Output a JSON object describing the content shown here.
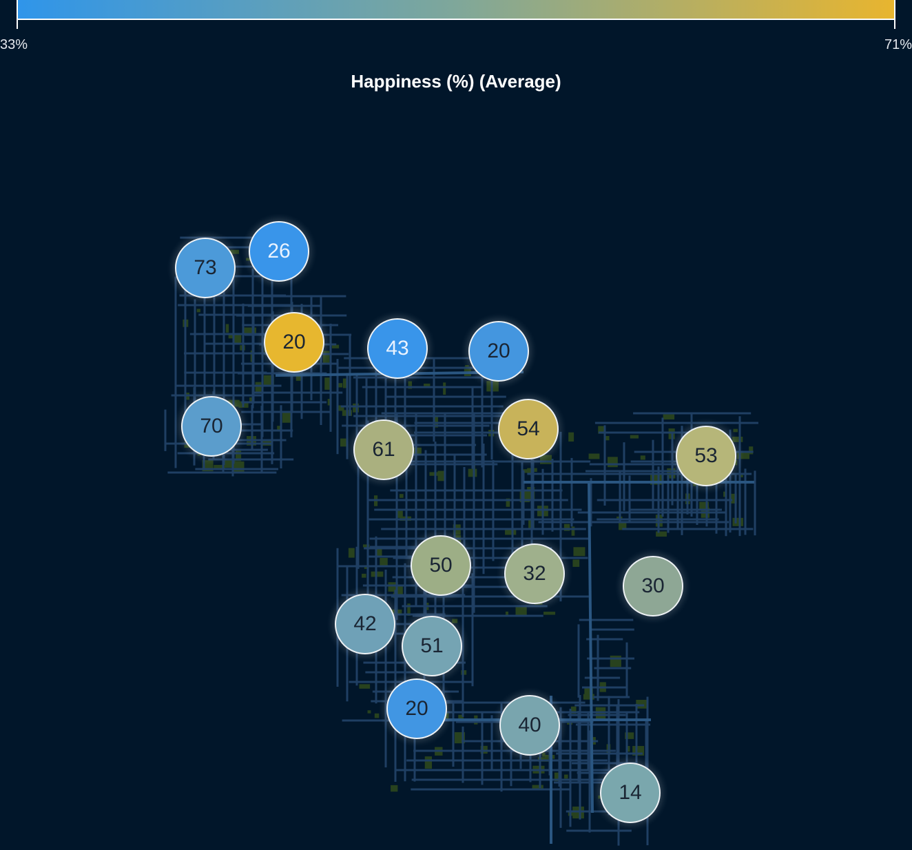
{
  "legend": {
    "min_label": "33%",
    "max_label": "71%",
    "color_start": "#2f95ea",
    "color_mid": "#7fa79a",
    "color_end": "#e8b52f"
  },
  "title": "Happiness (%) (Average)",
  "colors": {
    "background": "#01162a",
    "road": "#1f3f63",
    "vegetation": "#2f4a1c"
  },
  "map": {
    "bubbles": [
      {
        "label": "73",
        "happiness_pct": 38,
        "color": "#4c9ad9"
      },
      {
        "label": "26",
        "happiness_pct": 33,
        "color": "#3995ea"
      },
      {
        "label": "20",
        "happiness_pct": 71,
        "color": "#e7b72f"
      },
      {
        "label": "43",
        "happiness_pct": 33,
        "color": "#3995ea"
      },
      {
        "label": "20",
        "happiness_pct": 36,
        "color": "#4496df"
      },
      {
        "label": "70",
        "happiness_pct": 40,
        "color": "#5b9dcc"
      },
      {
        "label": "61",
        "happiness_pct": 61,
        "color": "#aab07f"
      },
      {
        "label": "54",
        "happiness_pct": 66,
        "color": "#c8b35a"
      },
      {
        "label": "53",
        "happiness_pct": 62,
        "color": "#b6b679"
      },
      {
        "label": "50",
        "happiness_pct": 58,
        "color": "#9dae86"
      },
      {
        "label": "32",
        "happiness_pct": 57,
        "color": "#9fb08c"
      },
      {
        "label": "30",
        "happiness_pct": 53,
        "color": "#8ea795"
      },
      {
        "label": "42",
        "happiness_pct": 45,
        "color": "#6fa1b7"
      },
      {
        "label": "51",
        "happiness_pct": 46,
        "color": "#75a4b3"
      },
      {
        "label": "20",
        "happiness_pct": 34,
        "color": "#4196e3"
      },
      {
        "label": "40",
        "happiness_pct": 48,
        "color": "#79a5ae"
      },
      {
        "label": "14",
        "happiness_pct": 48,
        "color": "#7aa7ad"
      }
    ]
  }
}
